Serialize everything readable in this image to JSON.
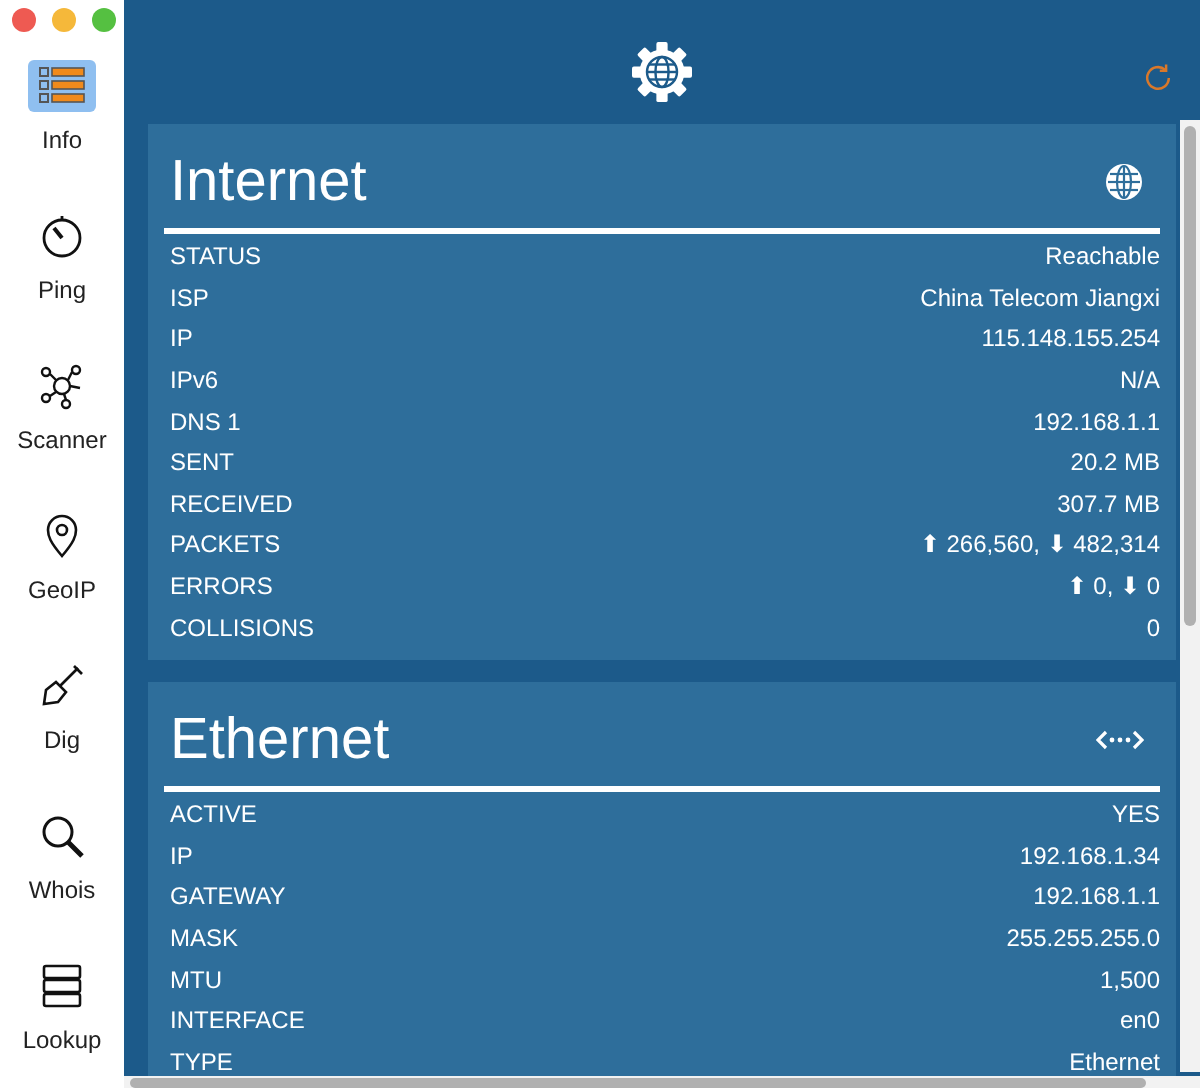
{
  "sidebar": {
    "items": [
      {
        "label": "Info",
        "selected": true
      },
      {
        "label": "Ping",
        "selected": false
      },
      {
        "label": "Scanner",
        "selected": false
      },
      {
        "label": "GeoIP",
        "selected": false
      },
      {
        "label": "Dig",
        "selected": false
      },
      {
        "label": "Whois",
        "selected": false
      },
      {
        "label": "Lookup",
        "selected": false
      }
    ]
  },
  "sections": [
    {
      "title": "Internet",
      "rows": [
        {
          "label": "STATUS",
          "value": "Reachable"
        },
        {
          "label": "ISP",
          "value": "China Telecom Jiangxi"
        },
        {
          "label": "IP",
          "value": "115.148.155.254"
        },
        {
          "label": "IPv6",
          "value": "N/A"
        },
        {
          "label": "DNS 1",
          "value": "192.168.1.1"
        },
        {
          "label": "SENT",
          "value": "20.2 MB"
        },
        {
          "label": "RECEIVED",
          "value": "307.7 MB"
        },
        {
          "label": "PACKETS",
          "value": "⬆ 266,560, ⬇ 482,314"
        },
        {
          "label": "ERRORS",
          "value": "⬆ 0, ⬇ 0"
        },
        {
          "label": "COLLISIONS",
          "value": "0"
        }
      ]
    },
    {
      "title": "Ethernet",
      "rows": [
        {
          "label": "ACTIVE",
          "value": "YES"
        },
        {
          "label": "IP",
          "value": "192.168.1.34"
        },
        {
          "label": "GATEWAY",
          "value": "192.168.1.1"
        },
        {
          "label": "MASK",
          "value": "255.255.255.0"
        },
        {
          "label": "MTU",
          "value": "1,500"
        },
        {
          "label": "INTERFACE",
          "value": "en0"
        },
        {
          "label": "TYPE",
          "value": "Ethernet"
        }
      ]
    }
  ]
}
